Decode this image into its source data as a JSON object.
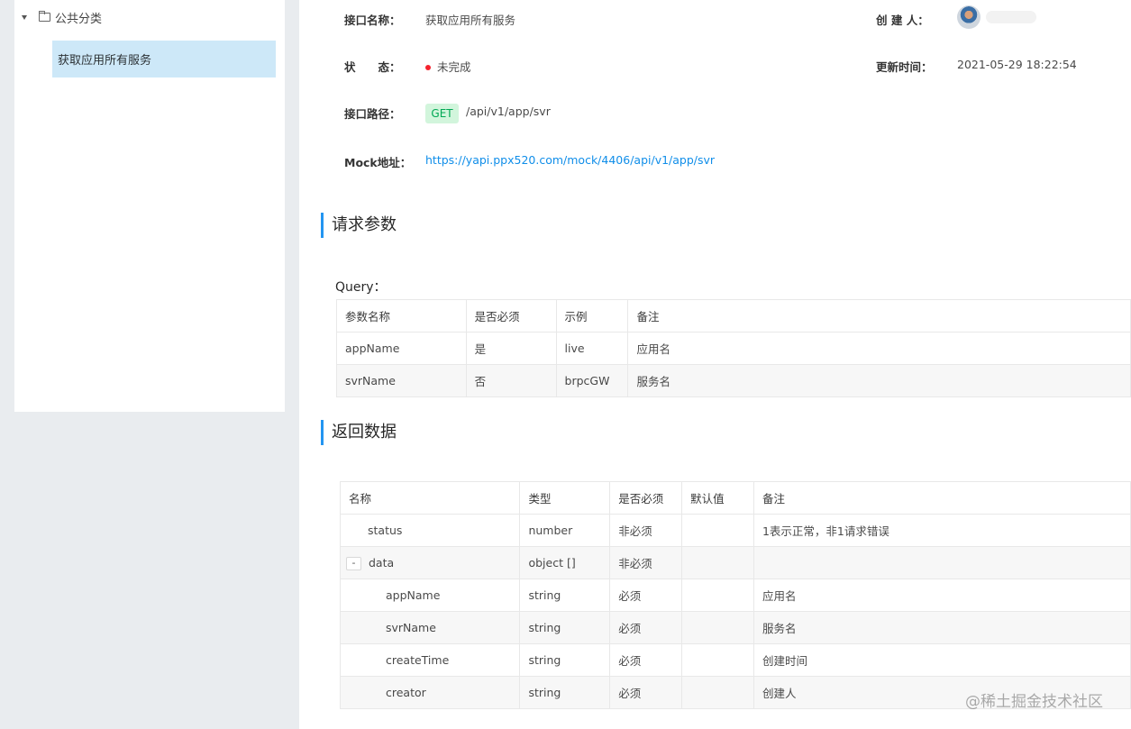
{
  "sidebar": {
    "category": "公共分类",
    "selected_item": "获取应用所有服务"
  },
  "info": {
    "name_label": "接口名称：",
    "name_value": "获取应用所有服务",
    "creator_label": "创 建 人：",
    "status_label": "状　　态：",
    "status_value": "未完成",
    "updated_label": "更新时间：",
    "updated_value": "2021-05-29 18:22:54",
    "path_label": "接口路径：",
    "method": "GET",
    "path_value": "/api/v1/app/svr",
    "mock_label": "Mock地址：",
    "mock_url": "https://yapi.ppx520.com/mock/4406/api/v1/app/svr",
    "status_color": "#f5222d",
    "method_color": "#00a854"
  },
  "request": {
    "title": "请求参数",
    "query_label": "Query：",
    "headers": [
      "参数名称",
      "是否必须",
      "示例",
      "备注"
    ],
    "rows": [
      [
        "appName",
        "是",
        "live",
        "应用名"
      ],
      [
        "svrName",
        "否",
        "brpcGW",
        "服务名"
      ]
    ]
  },
  "response": {
    "title": "返回数据",
    "headers": [
      "名称",
      "类型",
      "是否必须",
      "默认值",
      "备注"
    ],
    "rows": [
      [
        "status",
        "number",
        "非必须",
        "",
        "1表示正常，非1请求错误"
      ],
      [
        "data",
        "object []",
        "非必须",
        "",
        ""
      ],
      [
        "appName",
        "string",
        "必须",
        "",
        "应用名"
      ],
      [
        "svrName",
        "string",
        "必须",
        "",
        "服务名"
      ],
      [
        "createTime",
        "string",
        "必须",
        "",
        "创建时间"
      ],
      [
        "creator",
        "string",
        "必须",
        "",
        "创建人"
      ]
    ],
    "expand_symbol": "-"
  },
  "watermark": "@稀土掘金技术社区",
  "accent_color": "#2395f1"
}
